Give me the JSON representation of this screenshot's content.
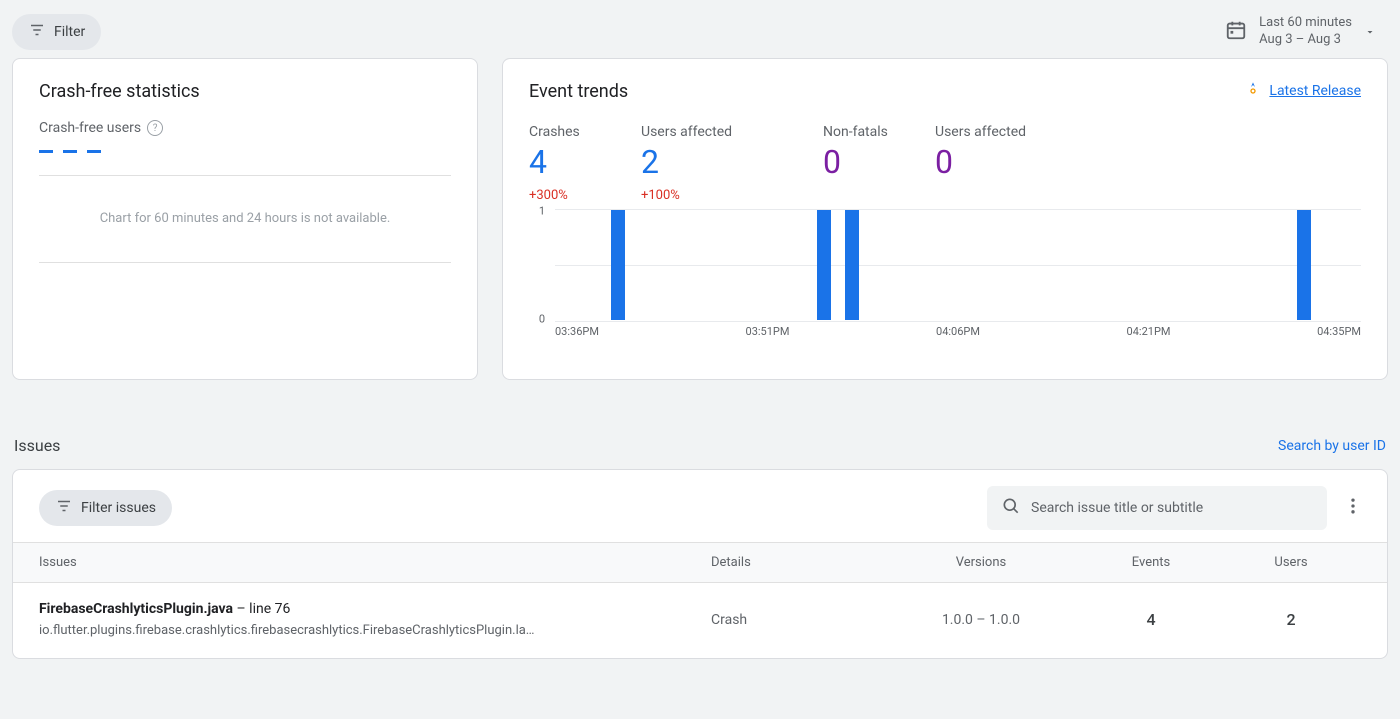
{
  "topbar": {
    "filter_label": "Filter",
    "date_line1": "Last 60 minutes",
    "date_line2": "Aug 3 – Aug 3"
  },
  "crash_free": {
    "title": "Crash-free statistics",
    "label": "Crash-free users",
    "unavailable": "Chart for 60 minutes and 24 hours is not available."
  },
  "trends": {
    "title": "Event trends",
    "link_label": "Latest Release",
    "metrics": {
      "crashes_label": "Crashes",
      "crashes_value": "4",
      "crashes_delta": "+300%",
      "ua1_label": "Users affected",
      "ua1_value": "2",
      "ua1_delta": "+100%",
      "nf_label": "Non-fatals",
      "nf_value": "0",
      "ua2_label": "Users affected",
      "ua2_value": "0"
    }
  },
  "chart_data": {
    "type": "bar",
    "categories": [
      "03:36PM",
      "03:51PM",
      "04:06PM",
      "04:21PM",
      "04:35PM"
    ],
    "values_indexed_at_minute_positions": [
      1,
      1,
      1,
      1
    ],
    "ylim": [
      0,
      1
    ],
    "yticks": [
      "1",
      "0"
    ],
    "xlabels": [
      "03:36PM",
      "03:51PM",
      "04:06PM",
      "04:21PM",
      "04:35PM"
    ]
  },
  "issues": {
    "heading": "Issues",
    "search_user_link": "Search by user ID",
    "filter_label": "Filter issues",
    "search_placeholder": "Search issue title or subtitle",
    "cols": {
      "issues": "Issues",
      "details": "Details",
      "versions": "Versions",
      "events": "Events",
      "users": "Users"
    },
    "rows": [
      {
        "file": "FirebaseCrashlyticsPlugin.java",
        "line_text": " – line 76",
        "sub": "io.flutter.plugins.firebase.crashlytics.firebasecrashlytics.FirebaseCrashlyticsPlugin.la…",
        "details": "Crash",
        "versions": "1.0.0 – 1.0.0",
        "events": "4",
        "users": "2"
      }
    ]
  }
}
